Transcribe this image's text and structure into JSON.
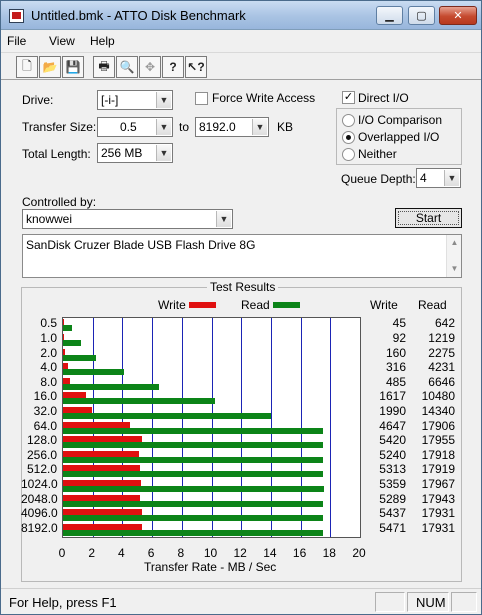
{
  "window": {
    "title": "Untitled.bmk - ATTO Disk Benchmark"
  },
  "menu": [
    "File",
    "View",
    "Help"
  ],
  "toolbar": {
    "buttons": [
      "new-icon",
      "open-icon",
      "save-icon",
      "print-icon",
      "print-preview-icon",
      "move-icon",
      "help-icon",
      "context-help-icon"
    ]
  },
  "form": {
    "drive_label": "Drive:",
    "drive_value": "[-i-]",
    "transfer_size_label": "Transfer Size:",
    "transfer_from": "0.5",
    "transfer_to_label": "to",
    "transfer_to": "8192.0",
    "transfer_unit": "KB",
    "total_length_label": "Total Length:",
    "total_length_value": "256 MB",
    "force_write_access_label": "Force Write Access",
    "force_write_access_checked": false,
    "direct_io_label": "Direct I/O",
    "direct_io_checked": true,
    "radio_options": [
      "I/O Comparison",
      "Overlapped I/O",
      "Neither"
    ],
    "selected_radio": "Overlapped I/O",
    "queue_depth_label": "Queue Depth:",
    "queue_depth_value": "4",
    "controlled_by_label": "Controlled by:",
    "controlled_by_value": "knowwei",
    "start_label": "Start",
    "description": "SanDisk Cruzer Blade USB Flash Drive 8G"
  },
  "results": {
    "title": "Test Results",
    "legend_write": "Write",
    "legend_read": "Read",
    "col_write": "Write",
    "col_read": "Read",
    "xaxis_title": "Transfer Rate - MB / Sec"
  },
  "chart_data": {
    "type": "bar",
    "title": "Test Results",
    "xlabel": "Transfer Rate - MB / Sec",
    "xlim": [
      0,
      20
    ],
    "xticks": [
      0,
      2,
      4,
      6,
      8,
      10,
      12,
      14,
      16,
      18,
      20
    ],
    "categories": [
      "0.5",
      "1.0",
      "2.0",
      "4.0",
      "8.0",
      "16.0",
      "32.0",
      "64.0",
      "128.0",
      "256.0",
      "512.0",
      "1024.0",
      "2048.0",
      "4096.0",
      "8192.0"
    ],
    "series": [
      {
        "name": "Write",
        "color": "#e01010",
        "values_kb": [
          45,
          92,
          160,
          316,
          485,
          1617,
          1990,
          4647,
          5420,
          5240,
          5313,
          5359,
          5289,
          5437,
          5471
        ]
      },
      {
        "name": "Read",
        "color": "#0c8418",
        "values_kb": [
          642,
          1219,
          2275,
          4231,
          6646,
          10480,
          14340,
          17906,
          17955,
          17918,
          17919,
          17967,
          17943,
          17931,
          17931
        ]
      }
    ]
  },
  "status": {
    "text": "For Help, press F1",
    "num": "NUM"
  }
}
